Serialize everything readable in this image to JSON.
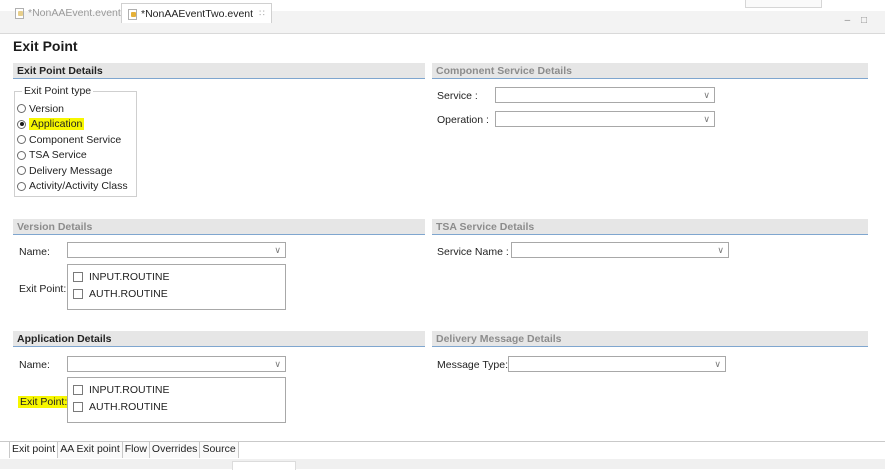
{
  "tabs": [
    {
      "label": "*NonAAEvent.event",
      "active": false
    },
    {
      "label": "*NonAAEventTwo.event",
      "active": true,
      "close": "∷"
    }
  ],
  "view_controls": "– □",
  "page_title": "Exit Point",
  "exit_point_details": {
    "header": "Exit Point Details",
    "group_label": "Exit Point type",
    "options": [
      {
        "label": "Version",
        "checked": false
      },
      {
        "label": "Application",
        "checked": true
      },
      {
        "label": "Component Service",
        "checked": false
      },
      {
        "label": "TSA Service",
        "checked": false
      },
      {
        "label": "Delivery Message",
        "checked": false
      },
      {
        "label": "Activity/Activity Class",
        "checked": false
      }
    ]
  },
  "component_service_details": {
    "header": "Component Service Details",
    "service_label": "Service :",
    "service_value": "",
    "operation_label": "Operation :",
    "operation_value": ""
  },
  "version_details": {
    "header": "Version Details",
    "name_label": "Name:",
    "name_value": "",
    "exit_point_label": "Exit Point:",
    "routines": [
      "INPUT.ROUTINE",
      "AUTH.ROUTINE"
    ]
  },
  "tsa_service_details": {
    "header": "TSA Service Details",
    "service_name_label": "Service Name :",
    "service_name_value": ""
  },
  "application_details": {
    "header": "Application Details",
    "name_label": "Name:",
    "name_value": "",
    "exit_point_label": "Exit Point:",
    "routines": [
      "INPUT.ROUTINE",
      "AUTH.ROUTINE"
    ]
  },
  "delivery_message_details": {
    "header": "Delivery Message Details",
    "message_type_label": "Message Type:",
    "message_type_value": ""
  },
  "bottom_tabs": [
    "Exit point",
    "AA Exit point",
    "Flow",
    "Overrides",
    "Source"
  ],
  "chevron_icon": "∨",
  "colors": {
    "highlight": "#f7f700",
    "section_rule": "#7fa6cf",
    "section_bg": "#e6e6e6"
  }
}
